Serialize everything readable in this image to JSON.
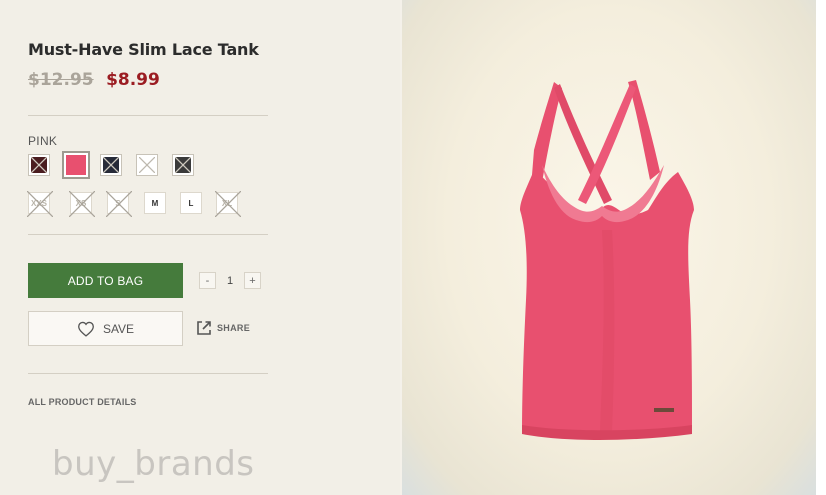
{
  "product": {
    "title": "Must-Have Slim Lace Tank",
    "original_price": "$12.95",
    "sale_price": "$8.99",
    "selected_color": "PINK"
  },
  "colors": {
    "sale_price_color": "#9b1c22",
    "add_to_bag_color": "#457b3c",
    "product_color": "#e8506f"
  },
  "swatches": [
    {
      "name": "burgundy",
      "color": "#4a1c1f",
      "unavailable": true,
      "selected": false
    },
    {
      "name": "pink",
      "color": "#e8506f",
      "unavailable": false,
      "selected": true
    },
    {
      "name": "navy",
      "color": "#262a38",
      "unavailable": true,
      "selected": false
    },
    {
      "name": "white",
      "color": "#ffffff",
      "unavailable": true,
      "selected": false
    },
    {
      "name": "charcoal",
      "color": "#3a3a3a",
      "unavailable": true,
      "selected": false
    }
  ],
  "sizes": [
    {
      "label": "XXS",
      "available": false
    },
    {
      "label": "XS",
      "available": false
    },
    {
      "label": "S",
      "available": false
    },
    {
      "label": "M",
      "available": true
    },
    {
      "label": "L",
      "available": true
    },
    {
      "label": "XL",
      "available": false
    }
  ],
  "actions": {
    "add_to_bag_label": "ADD TO BAG",
    "quantity": "1",
    "decrement_label": "-",
    "increment_label": "+",
    "save_label": "SAVE",
    "share_label": "SHARE",
    "details_label": "ALL PRODUCT DETAILS"
  },
  "watermark": "buy_brands"
}
